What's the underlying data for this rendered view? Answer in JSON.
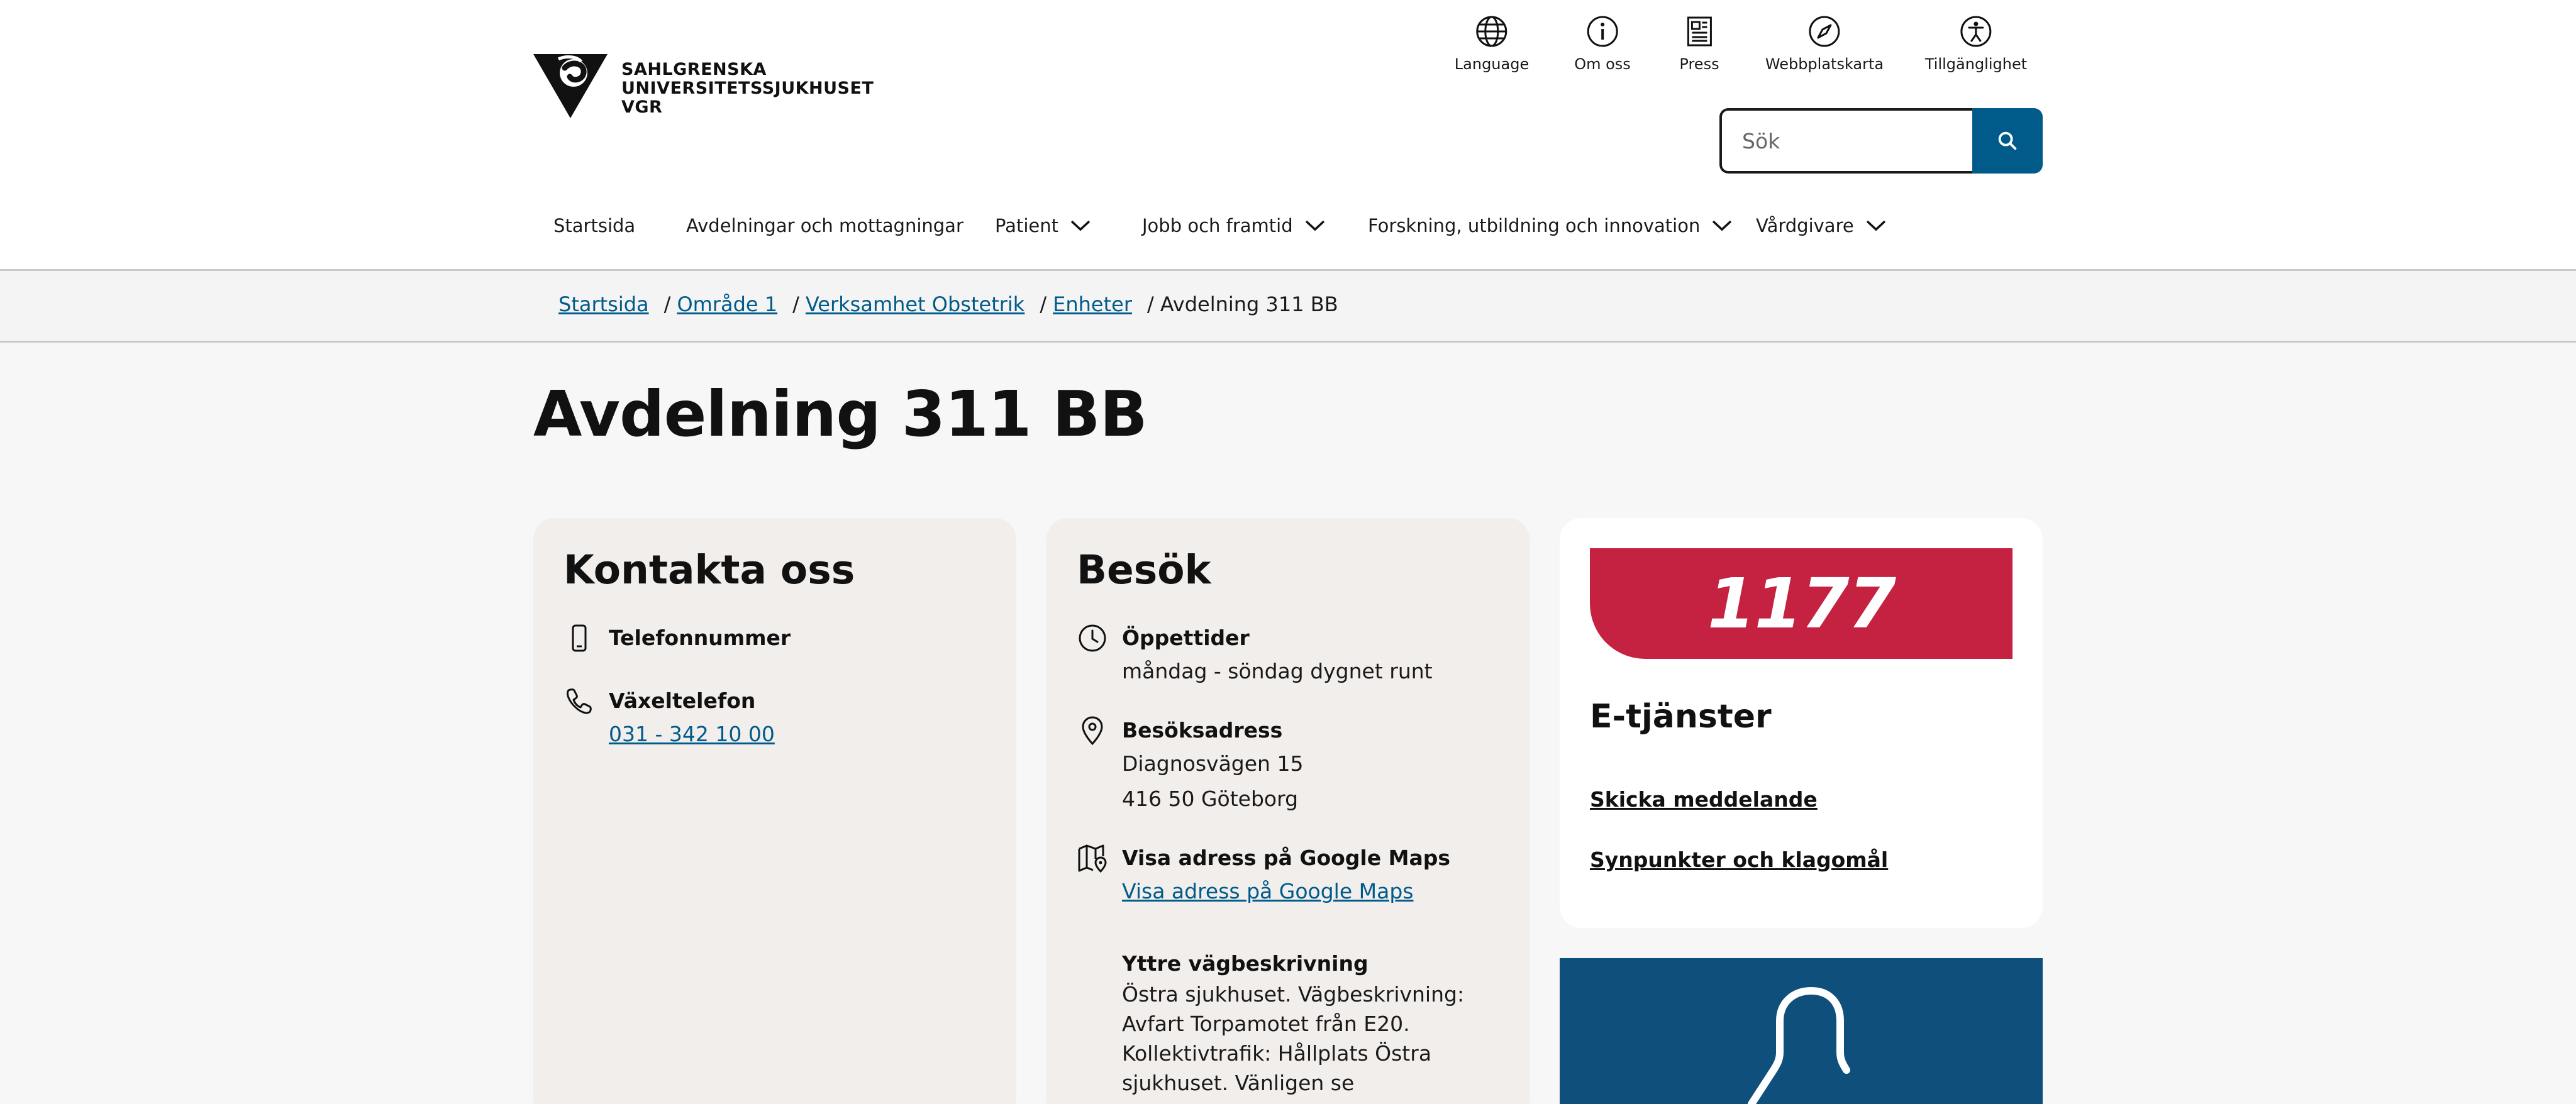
{
  "logo": {
    "line1": "SAHLGRENSKA",
    "line2": "UNIVERSITETSSJUKHUSET",
    "line3": "VGR"
  },
  "utility_nav": [
    {
      "label": "Language",
      "icon": "globe-icon"
    },
    {
      "label": "Om oss",
      "icon": "info-icon"
    },
    {
      "label": "Press",
      "icon": "newspaper-icon"
    },
    {
      "label": "Webbplatskarta",
      "icon": "compass-icon"
    },
    {
      "label": "Tillgänglighet",
      "icon": "accessibility-icon"
    }
  ],
  "search": {
    "placeholder": "Sök",
    "icon": "search-icon"
  },
  "main_nav": [
    {
      "label": "Startsida",
      "has_dropdown": false
    },
    {
      "label": "Avdelningar och mottagningar",
      "has_dropdown": false
    },
    {
      "label": "Patient",
      "has_dropdown": true
    },
    {
      "label": "Jobb och framtid",
      "has_dropdown": true
    },
    {
      "label": "Forskning, utbildning och innovation",
      "has_dropdown": true
    },
    {
      "label": "Vårdgivare",
      "has_dropdown": true
    }
  ],
  "breadcrumb": {
    "items": [
      "Startsida",
      "Område 1",
      "Verksamhet Obstetrik",
      "Enheter"
    ],
    "current": "Avdelning 311 BB",
    "separator": "/"
  },
  "page": {
    "title": "Avdelning 311 BB"
  },
  "contact": {
    "title": "Kontakta oss",
    "phone_label": "Telefonnummer",
    "switchboard_label": "Växeltelefon",
    "switchboard_number": "031 - 342 10 00"
  },
  "visit": {
    "title": "Besök",
    "hours_label": "Öppettider",
    "hours_value": "måndag - söndag dygnet runt",
    "address_label": "Besöksadress",
    "address_line1": "Diagnosvägen 15",
    "address_line2": "416 50 Göteborg",
    "maps_label": "Visa adress på Google Maps",
    "maps_link": "Visa adress på Google Maps",
    "directions_label": "Yttre vägbeskrivning",
    "directions_text": "Östra sjukhuset. Vägbeskrivning: Avfart Torpamotet från E20. Kollektivtrafik: Hållplats Östra sjukhuset. Vänligen se www.vasttrafik.se för information. Se"
  },
  "eservices": {
    "logo_text": "1177",
    "title": "E-tjänster",
    "link1": "Skicka meddelande",
    "link2": "Synpunkter och klagomål"
  },
  "colors": {
    "link": "#005b8a",
    "search_button": "#005b8a",
    "brand_1177": "#c52140",
    "blue_card": "#0e4f7c",
    "card_bg": "#f1eeec"
  }
}
